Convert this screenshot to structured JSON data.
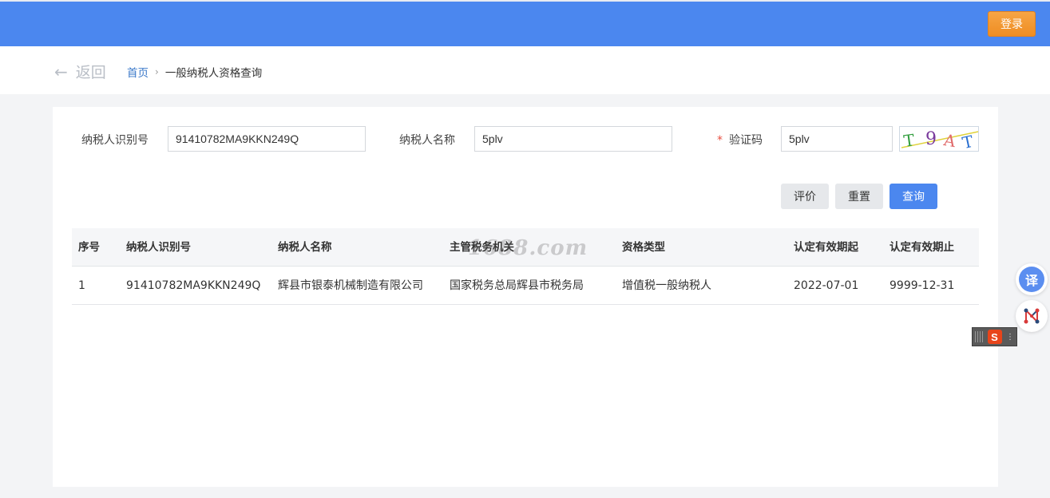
{
  "header": {
    "login_label": "登录"
  },
  "nav": {
    "back_label": "返回",
    "breadcrumb": {
      "home": "首页",
      "separator": "›",
      "current": "一般纳税人资格查询"
    }
  },
  "form": {
    "taxpayer_id_label": "纳税人识别号",
    "taxpayer_id_value": "91410782MA9KKN249Q",
    "taxpayer_name_label": "纳税人名称",
    "taxpayer_name_value": "5plv",
    "required_mark": "*",
    "captcha_label": "验证码",
    "captcha_value": "5plv",
    "captcha_image_text": "T9AT"
  },
  "buttons": {
    "rate": "评价",
    "reset": "重置",
    "query": "查询"
  },
  "table": {
    "headers": [
      "序号",
      "纳税人识别号",
      "纳税人名称",
      "主管税务机关",
      "资格类型",
      "认定有效期起",
      "认定有效期止"
    ],
    "rows": [
      [
        "1",
        "91410782MA9KKN249Q",
        "辉县市银泰机械制造有限公司",
        "国家税务总局辉县市税务局",
        "增值税一般纳税人",
        "2022-07-01",
        "9999-12-31"
      ]
    ]
  },
  "watermark": "1688.com",
  "side_tools": {
    "translate_label": "译"
  },
  "ime": {
    "logo": "S"
  },
  "colors": {
    "primary": "#4b87ef",
    "login": "#f39a30",
    "required": "#e84e40"
  },
  "icons": [
    "back-arrow-icon",
    "breadcrumb-chevron-icon",
    "translate-icon",
    "graph-icon",
    "ime-logo-icon"
  ]
}
